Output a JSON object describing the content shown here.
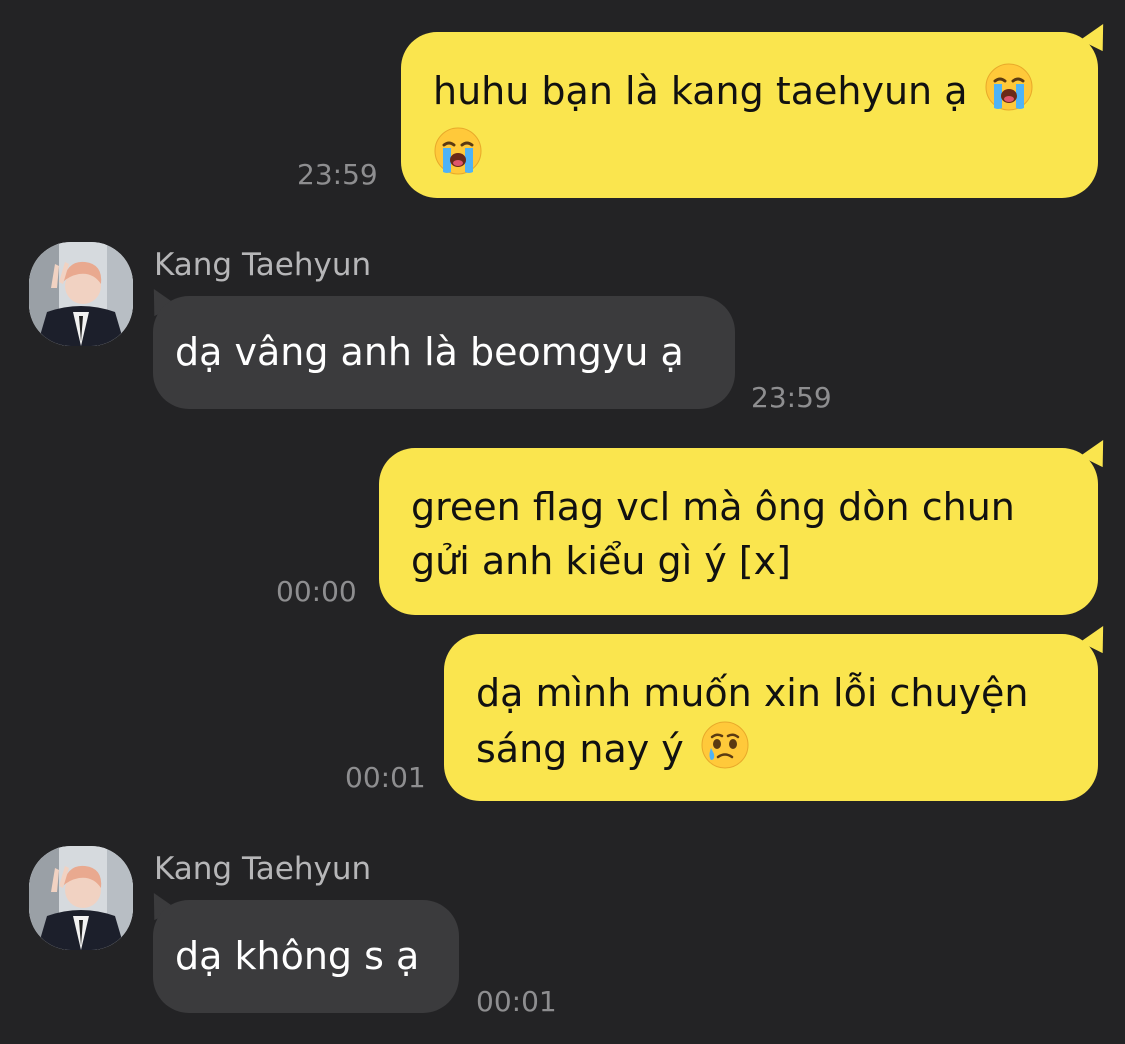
{
  "colors": {
    "background": "#232325",
    "outgoing_bubble": "#fae54e",
    "incoming_bubble": "#3b3b3d",
    "timestamp": "#8e8e90",
    "sender_name": "#b6b6b8"
  },
  "messages": [
    {
      "direction": "outgoing",
      "text": "huhu bạn là kang taehyun ạ",
      "emoji": "loudly-crying-face-icon",
      "emoji_count": 2,
      "time": "23:59"
    },
    {
      "direction": "incoming",
      "sender": "Kang Taehyun",
      "avatar": "profile-photo",
      "text": "dạ vâng anh là beomgyu ạ",
      "time": "23:59"
    },
    {
      "direction": "outgoing",
      "text_line1": "green flag vcl mà ông dòn chun",
      "text_line2": "gửi anh kiểu gì ý [x]",
      "time": "00:00"
    },
    {
      "direction": "outgoing",
      "text_line1": "dạ mình muốn xin lỗi chuyện",
      "text_line2": "sáng nay ý",
      "emoji": "face-holding-back-tears-icon",
      "time": "00:01"
    },
    {
      "direction": "incoming",
      "sender": "Kang Taehyun",
      "avatar": "profile-photo",
      "text": "dạ không s ạ",
      "time": "00:01"
    }
  ]
}
